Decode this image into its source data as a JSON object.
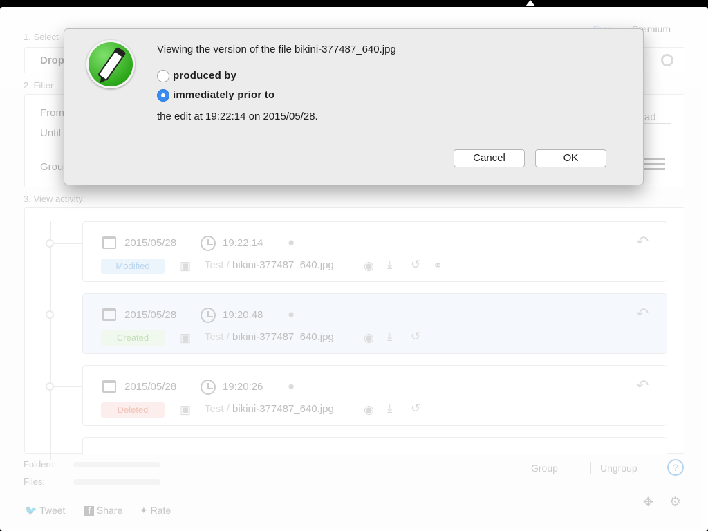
{
  "app": {
    "tabs": {
      "free": "Free",
      "premium": "Premium"
    },
    "step1": {
      "label": "1. Select",
      "dropdown": "Drop"
    },
    "step2": {
      "label": "2. Filter",
      "from": "From",
      "until": "Until",
      "group": "Grou",
      "right_value": "ad"
    },
    "step3": {
      "label": "3. View activity:"
    },
    "activity": [
      {
        "date": "2015/05/28",
        "time": "19:22:14",
        "status": "Modified",
        "folder": "Test",
        "file": "bikini-377487_640.jpg"
      },
      {
        "date": "2015/05/28",
        "time": "19:20:48",
        "status": "Created",
        "folder": "Test",
        "file": "bikini-377487_640.jpg"
      },
      {
        "date": "2015/05/28",
        "time": "19:20:26",
        "status": "Deleted",
        "folder": "Test",
        "file": "bikini-377487_640.jpg"
      }
    ],
    "path_separator": " / ",
    "footer": {
      "folders_label": "Folders:",
      "files_label": "Files:",
      "group_btn": "Group",
      "ungroup_btn": "Ungroup",
      "help": "?",
      "tweet": "Tweet",
      "share": "Share",
      "rate": "Rate"
    }
  },
  "dialog": {
    "title": "Viewing the version of the file bikini-377487_640.jpg",
    "options": [
      {
        "label": "produced by",
        "selected": false
      },
      {
        "label": "immediately prior to",
        "selected": true
      }
    ],
    "edit_text": "the edit at 19:22:14 on 2015/05/28.",
    "cancel_label": "Cancel",
    "ok_label": "OK",
    "accent_color": "#3b8cf1"
  }
}
